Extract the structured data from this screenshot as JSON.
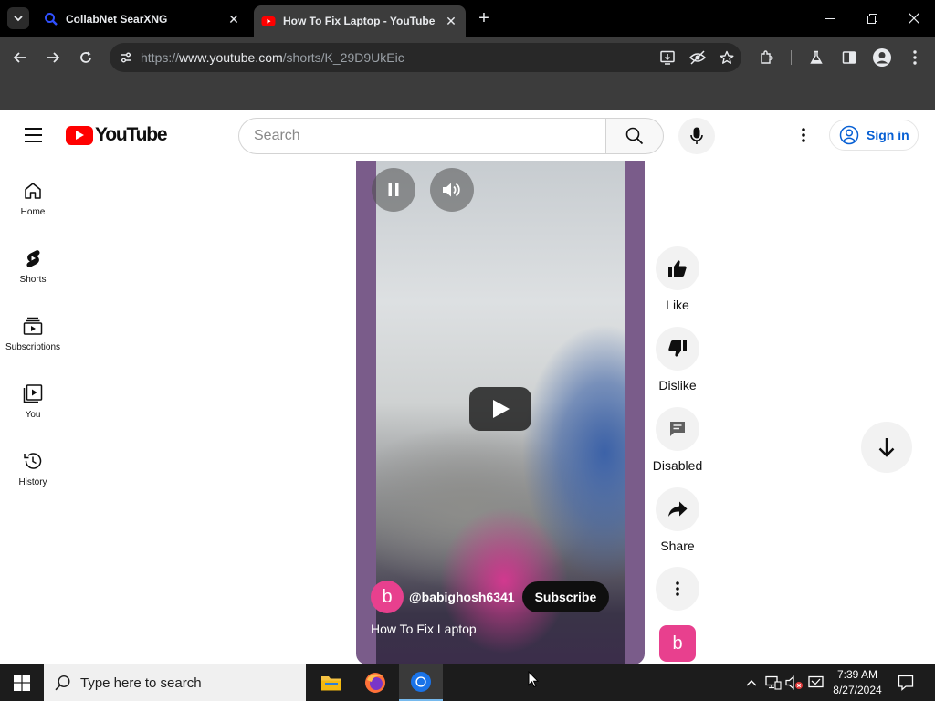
{
  "browser": {
    "tabs": [
      {
        "title": "CollabNet SearXNG",
        "icon": "search-favicon",
        "active": false
      },
      {
        "title": "How To Fix Laptop - YouTube",
        "icon": "youtube-favicon",
        "active": true
      }
    ],
    "address": {
      "prefix": "https://",
      "domain": "www.youtube.com",
      "path": "/shorts/K_29D9UkEic"
    },
    "icons": [
      "tab-search-icon",
      "back-icon",
      "forward-icon",
      "reload-icon",
      "site-info-icon",
      "install-app-icon",
      "tracking-protection-icon",
      "bookmark-star-icon",
      "extensions-icon",
      "labs-icon",
      "side-panel-icon",
      "profile-icon",
      "kebab-menu-icon",
      "minimize-icon",
      "maximize-icon",
      "close-icon"
    ]
  },
  "youtube": {
    "logo_text": "YouTube",
    "search_placeholder": "Search",
    "signin_label": "Sign in",
    "brand_color": "#ff0000",
    "link_color": "#065fd4",
    "sidebar": [
      {
        "label": "Home",
        "icon": "home-icon"
      },
      {
        "label": "Shorts",
        "icon": "shorts-icon"
      },
      {
        "label": "Subscriptions",
        "icon": "subscriptions-icon"
      },
      {
        "label": "You",
        "icon": "you-icon"
      },
      {
        "label": "History",
        "icon": "history-icon"
      }
    ],
    "short": {
      "channel_initial": "b",
      "channel_handle": "@babighosh6341",
      "subscribe_label": "Subscribe",
      "title": "How To Fix Laptop",
      "avatar_color": "#e8408e"
    },
    "actions": [
      {
        "label": "Like",
        "icon": "thumbs-up-icon"
      },
      {
        "label": "Dislike",
        "icon": "thumbs-down-icon"
      },
      {
        "label": "Disabled",
        "icon": "comments-disabled-icon"
      },
      {
        "label": "Share",
        "icon": "share-icon"
      },
      {
        "label": "",
        "icon": "more-vertical-icon"
      }
    ],
    "reel_avatar_initial": "b"
  },
  "taskbar": {
    "search_placeholder": "Type here to search",
    "apps": [
      "file-explorer-icon",
      "firefox-icon",
      "chrome-icon"
    ],
    "time": "7:39 AM",
    "date": "8/27/2024"
  }
}
